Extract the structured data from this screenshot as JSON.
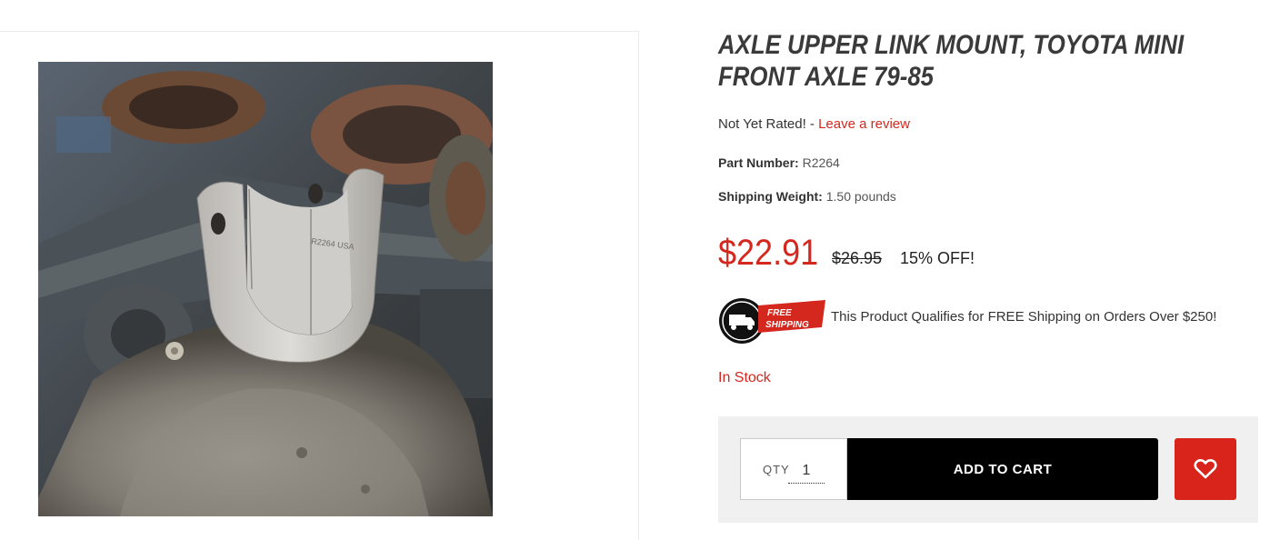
{
  "product": {
    "title": "AXLE UPPER LINK MOUNT, TOYOTA MINI FRONT AXLE 79-85",
    "image_alt": "Axle upper link mount photo",
    "image_stamp": "R2264 USA",
    "rating_text": "Not Yet Rated! - ",
    "review_link": "Leave a review",
    "part_number_label": "Part Number:",
    "part_number": "R2264",
    "shipping_weight_label": "Shipping Weight:",
    "shipping_weight": "1.50 pounds",
    "price": "$22.91",
    "old_price": "$26.95",
    "discount": "15% OFF!",
    "badge_line1": "FREE",
    "badge_line2": "SHIPPING",
    "free_shipping_text": "This Product Qualifies for FREE Shipping on Orders Over $250!",
    "stock_status": "In Stock"
  },
  "cart": {
    "qty_label": "QTY",
    "qty_value": "1",
    "add_to_cart_label": "ADD TO CART"
  },
  "colors": {
    "accent": "#d4281f",
    "button_dark": "#000000",
    "wishlist": "#d9241c"
  }
}
